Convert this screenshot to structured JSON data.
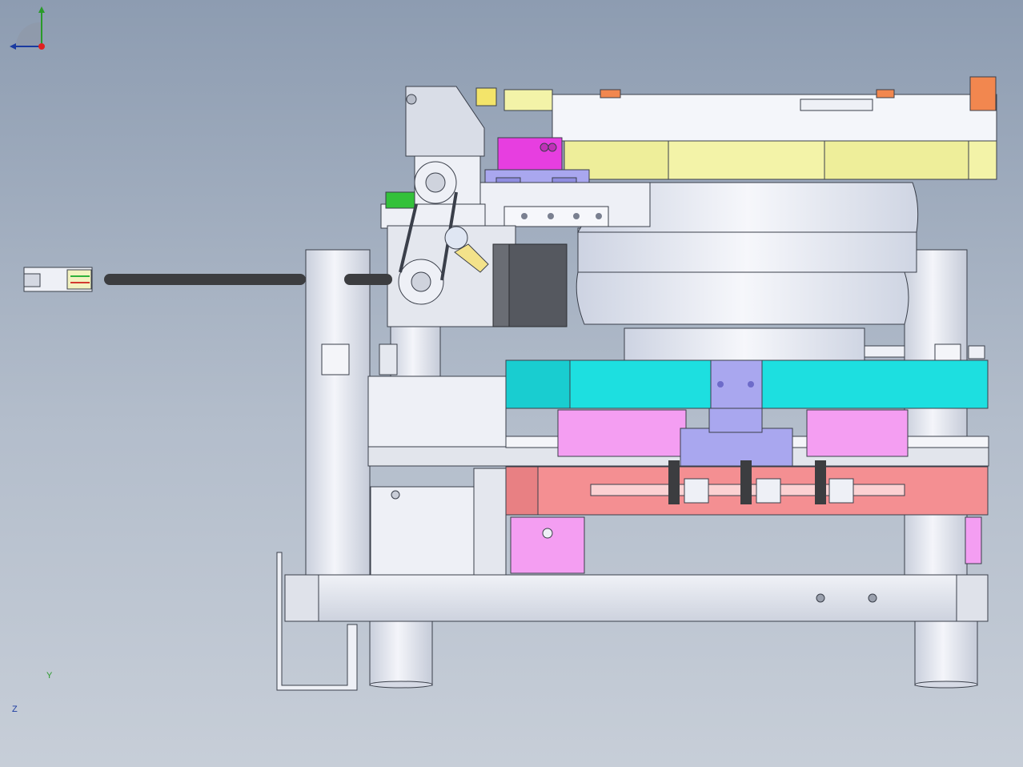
{
  "viewport": {
    "background_top": "#8d9cb1",
    "background_bottom": "#c7ced8"
  },
  "model": {
    "colors": {
      "frame": "#e7eaf3",
      "frame_stroke": "#3a3f4a",
      "yellow_plate": "#f3f3a8",
      "cyan_block": "#1ddfe0",
      "pink_block": "#f49ef2",
      "salmon_block": "#f48f92",
      "magenta_part": "#e73ee0",
      "lavender_part": "#a9a7ef",
      "orange_part": "#f2874f",
      "motor_dark": "#55585f",
      "cable": "#3c3d40"
    }
  },
  "triad": {
    "y_label": "Y",
    "z_label": "Z",
    "icon": "coordinate-triad-icon"
  }
}
